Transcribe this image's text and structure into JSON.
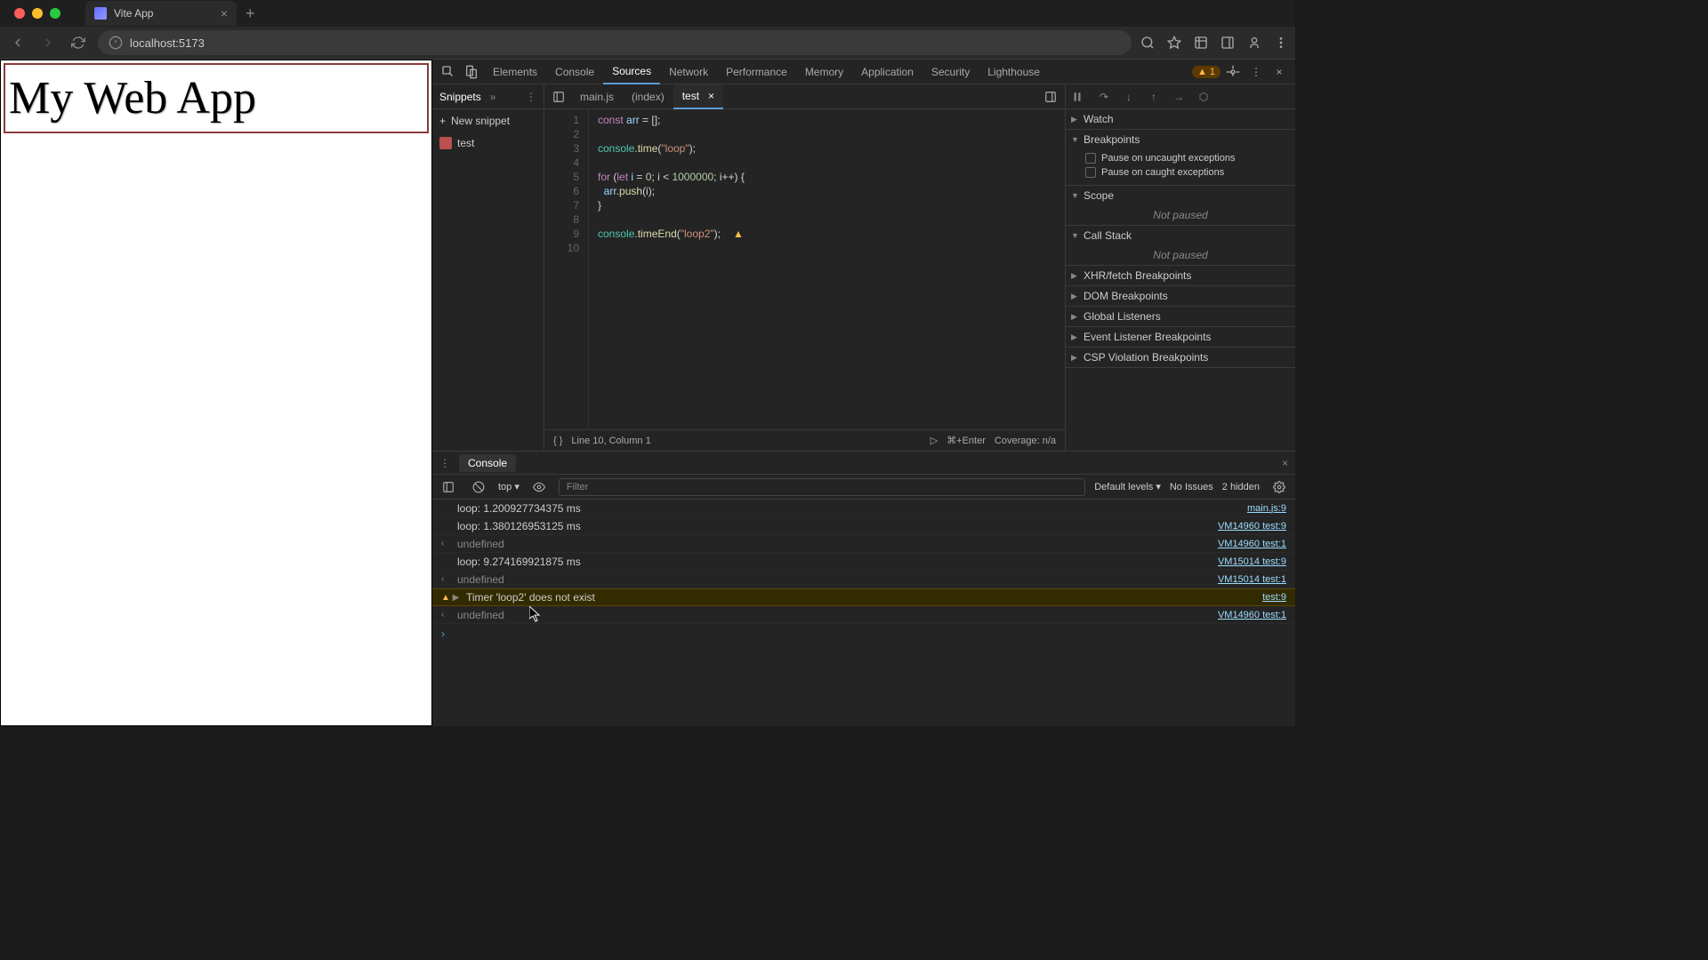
{
  "browser": {
    "tab_title": "Vite App",
    "url": "localhost:5173"
  },
  "page": {
    "heading": "My Web App"
  },
  "devtools": {
    "tabs": [
      "Elements",
      "Console",
      "Sources",
      "Network",
      "Performance",
      "Memory",
      "Application",
      "Security",
      "Lighthouse"
    ],
    "active_tab": "Sources",
    "warn_count": "1"
  },
  "snippets": {
    "header": "Snippets",
    "new_label": "New snippet",
    "items": [
      "test"
    ]
  },
  "editor": {
    "tabs": [
      {
        "label": "main.js",
        "active": false
      },
      {
        "label": "(index)",
        "active": false
      },
      {
        "label": "test",
        "active": true
      }
    ],
    "code": {
      "lines": [
        "1",
        "2",
        "3",
        "4",
        "5",
        "6",
        "7",
        "8",
        "9",
        "10"
      ],
      "line1_kw": "const",
      "line1_id": "arr",
      "line1_rest": " = [];",
      "line3_a": "console",
      "line3_b": "time",
      "line3_str": "\"loop\"",
      "line5_for": "for",
      "line5_let": "let",
      "line5_i": "i",
      "line5_eq": " = ",
      "line5_z": "0",
      "line5_cond": "; i < ",
      "line5_max": "1000000",
      "line5_inc": "; i++) {",
      "line6_a": "arr",
      "line6_b": "push",
      "line6_arg": "(i);",
      "line7": "}",
      "line9_a": "console",
      "line9_b": "timeEnd",
      "line9_str": "\"loop2\""
    },
    "status_line": "Line 10, Column 1",
    "status_run": "⌘+Enter",
    "status_cov": "Coverage: n/a"
  },
  "debugger": {
    "sections": {
      "watch": "Watch",
      "breakpoints": "Breakpoints",
      "bp_uncaught": "Pause on uncaught exceptions",
      "bp_caught": "Pause on caught exceptions",
      "scope": "Scope",
      "callstack": "Call Stack",
      "not_paused": "Not paused",
      "xhr": "XHR/fetch Breakpoints",
      "dom": "DOM Breakpoints",
      "listeners": "Global Listeners",
      "event": "Event Listener Breakpoints",
      "csp": "CSP Violation Breakpoints"
    }
  },
  "console": {
    "tab": "Console",
    "context": "top",
    "filter_placeholder": "Filter",
    "levels": "Default levels",
    "issues": "No Issues",
    "hidden": "2 hidden",
    "rows": [
      {
        "type": "log",
        "msg": "loop: 1.200927734375 ms",
        "src": "main.js:9"
      },
      {
        "type": "log",
        "msg": "loop: 1.380126953125 ms",
        "src": "VM14960 test:9"
      },
      {
        "type": "return",
        "msg": "undefined",
        "src": "VM14960 test:1"
      },
      {
        "type": "log",
        "msg": "loop: 9.274169921875 ms",
        "src": "VM15014 test:9"
      },
      {
        "type": "return",
        "msg": "undefined",
        "src": "VM15014 test:1"
      },
      {
        "type": "warn",
        "msg": "Timer 'loop2' does not exist",
        "src": "test:9"
      },
      {
        "type": "return",
        "msg": "undefined",
        "src": "VM14960 test:1"
      }
    ]
  }
}
